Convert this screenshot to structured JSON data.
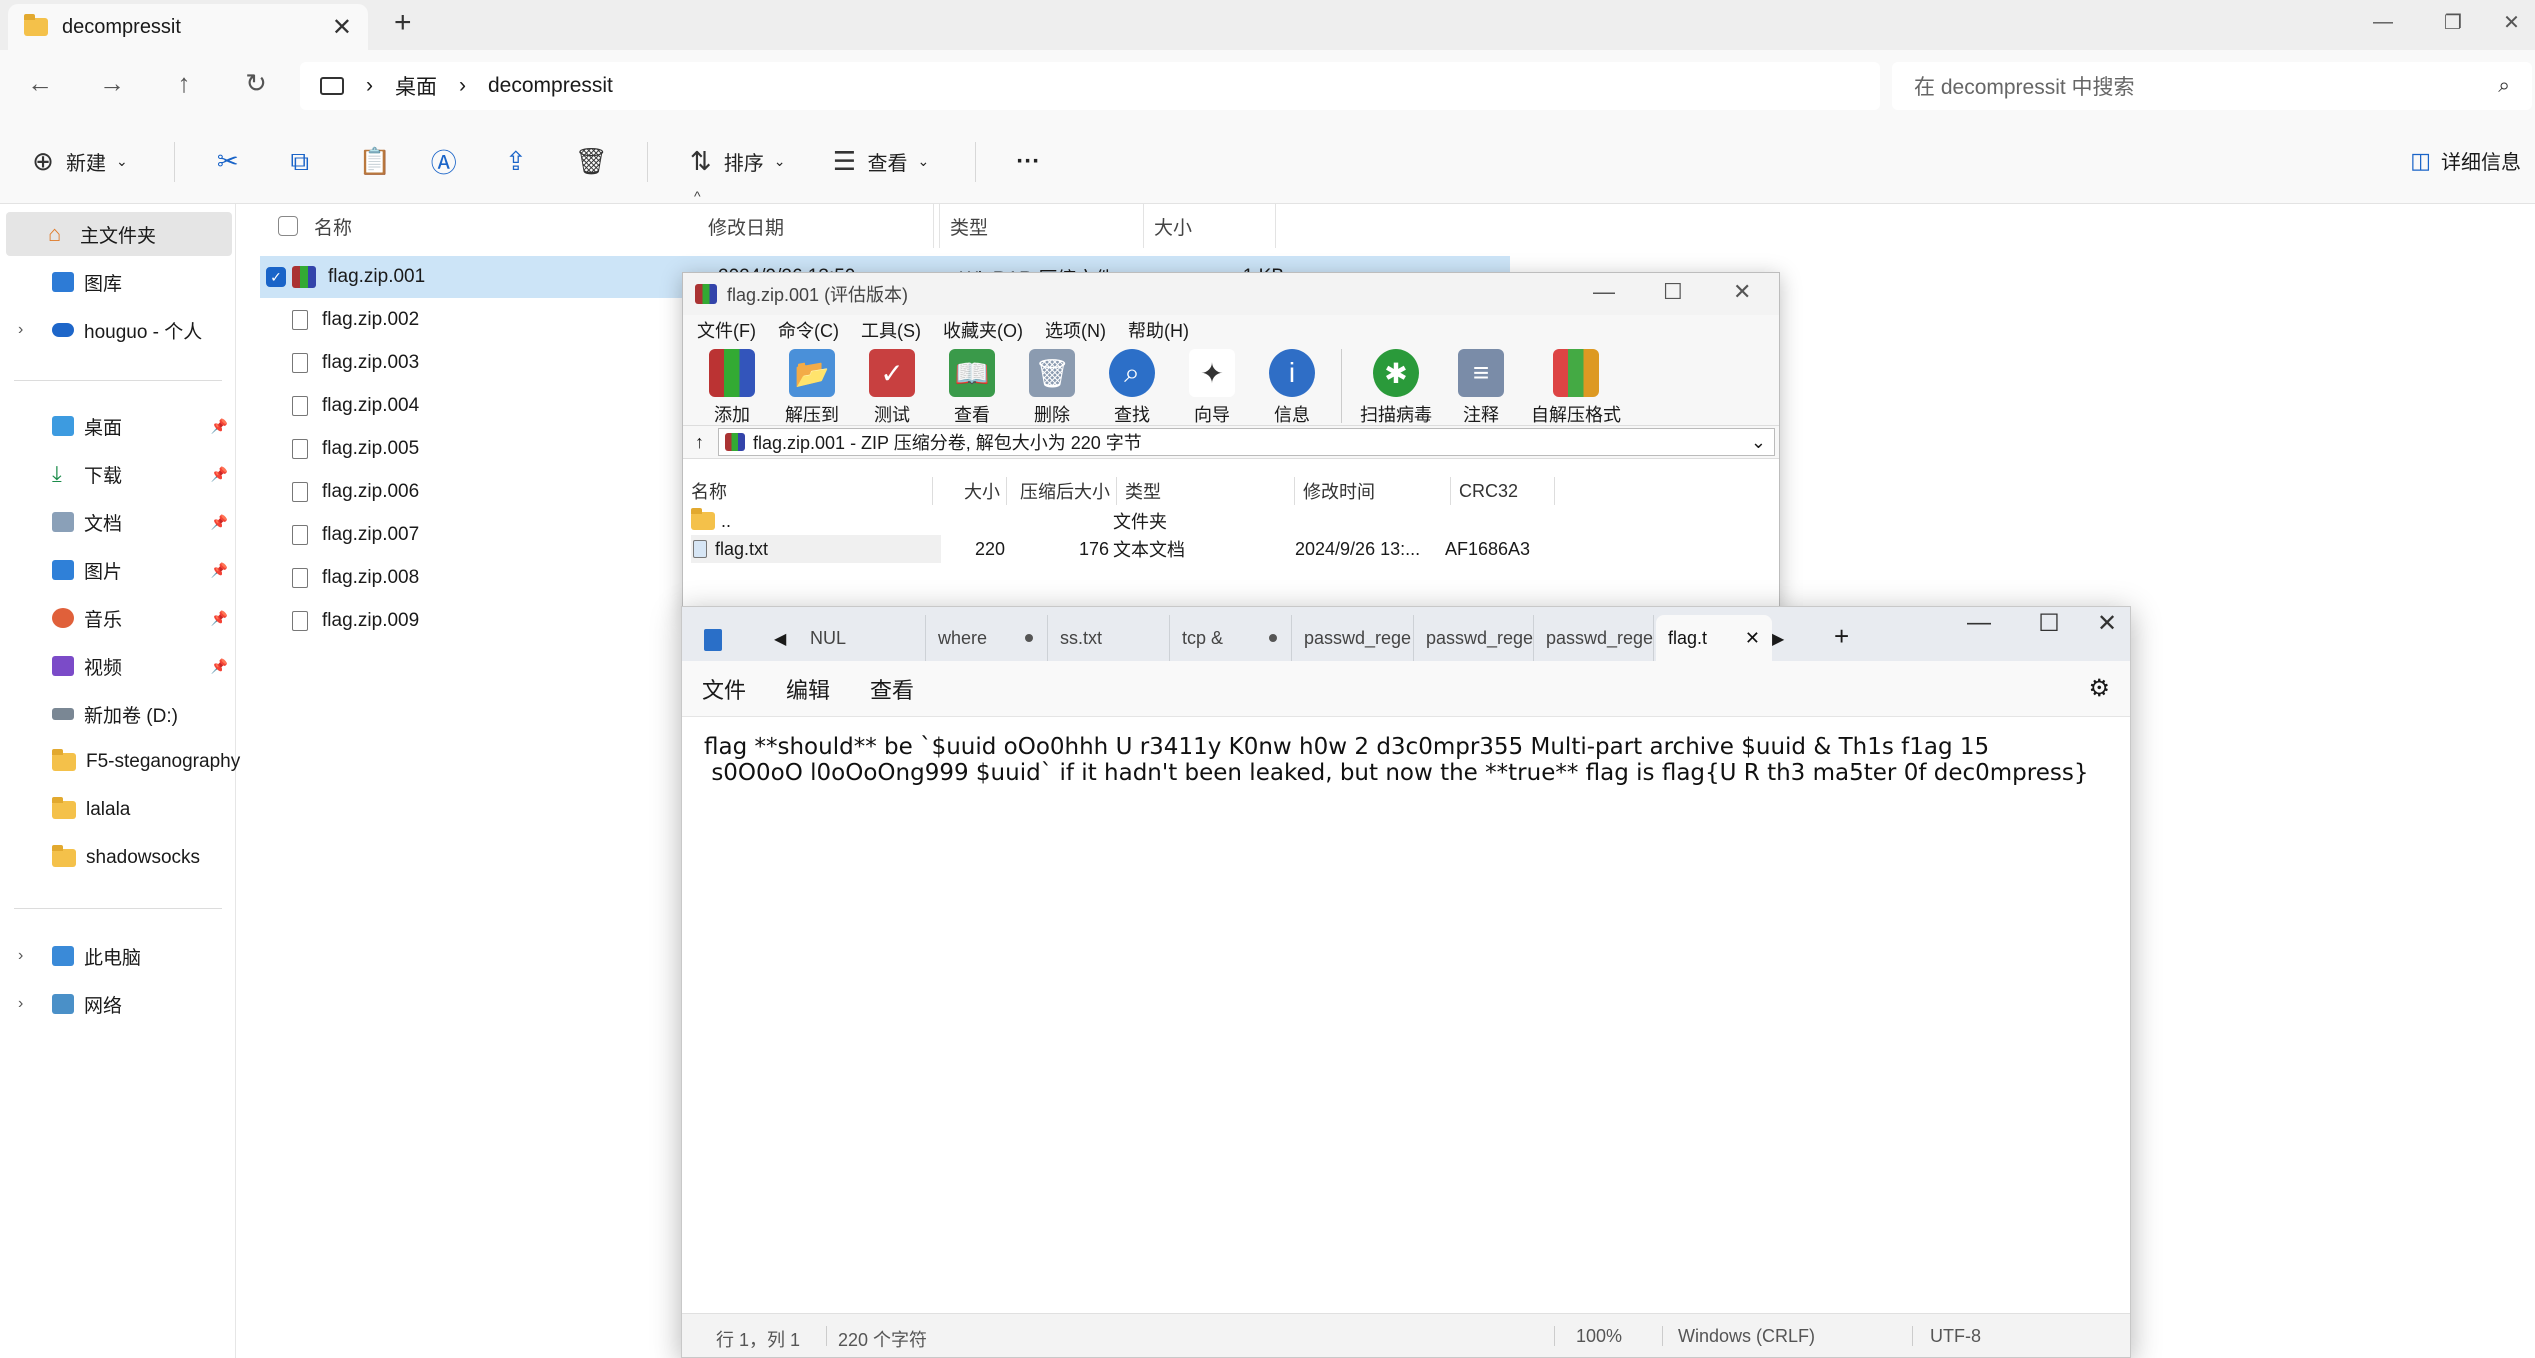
{
  "explorer": {
    "tab_title": "decompressit",
    "new_tab": "+",
    "breadcrumb": [
      "桌面",
      "decompressit"
    ],
    "search_placeholder": "在 decompressit 中搜索",
    "commands": {
      "new": "新建",
      "sort": "排序",
      "view": "查看",
      "more": "···",
      "details": "详细信息"
    },
    "sidebar": [
      {
        "label": "主文件夹",
        "icon": "home-icon",
        "pinned": false,
        "selected": true
      },
      {
        "label": "图库",
        "icon": "gallery-icon",
        "pinned": false
      },
      {
        "label": "houguo - 个人",
        "icon": "onedrive-icon",
        "pinned": false
      },
      {
        "label": "桌面",
        "icon": "desktop-icon",
        "pinned": true
      },
      {
        "label": "下载",
        "icon": "download-icon",
        "pinned": true
      },
      {
        "label": "文档",
        "icon": "documents-icon",
        "pinned": true
      },
      {
        "label": "图片",
        "icon": "pictures-icon",
        "pinned": true
      },
      {
        "label": "音乐",
        "icon": "music-icon",
        "pinned": true
      },
      {
        "label": "视频",
        "icon": "video-icon",
        "pinned": true
      },
      {
        "label": "新加卷 (D:)",
        "icon": "drive-icon",
        "pinned": false
      },
      {
        "label": "F5-steganography",
        "icon": "folder-icon",
        "pinned": false
      },
      {
        "label": "lalala",
        "icon": "folder-icon",
        "pinned": false
      },
      {
        "label": "shadowsocks",
        "icon": "folder-icon",
        "pinned": false
      },
      {
        "label": "此电脑",
        "icon": "computer-icon",
        "pinned": false
      },
      {
        "label": "网络",
        "icon": "network-icon",
        "pinned": false
      }
    ],
    "columns": [
      "名称",
      "修改日期",
      "类型",
      "大小"
    ],
    "files": [
      {
        "name": "flag.zip.001",
        "date": "2024/9/26 13:50",
        "type": "WinRAR 压缩文件",
        "size": "1 KB",
        "selected": true
      },
      {
        "name": "flag.zip.002"
      },
      {
        "name": "flag.zip.003"
      },
      {
        "name": "flag.zip.004"
      },
      {
        "name": "flag.zip.005"
      },
      {
        "name": "flag.zip.006"
      },
      {
        "name": "flag.zip.007"
      },
      {
        "name": "flag.zip.008"
      },
      {
        "name": "flag.zip.009"
      }
    ]
  },
  "winrar": {
    "title": "flag.zip.001 (评估版本)",
    "menu": [
      "文件(F)",
      "命令(C)",
      "工具(S)",
      "收藏夹(O)",
      "选项(N)",
      "帮助(H)"
    ],
    "tools": [
      "添加",
      "解压到",
      "测试",
      "查看",
      "删除",
      "查找",
      "向导",
      "信息",
      "扫描病毒",
      "注释",
      "自解压格式"
    ],
    "path": "flag.zip.001 - ZIP 压缩分卷, 解包大小为 220 字节",
    "columns": [
      "名称",
      "大小",
      "压缩后大小",
      "类型",
      "修改时间",
      "CRC32"
    ],
    "rows": [
      {
        "name": "..",
        "size": "",
        "packed": "",
        "type": "文件夹",
        "modified": "",
        "crc": ""
      },
      {
        "name": "flag.txt",
        "size": "220",
        "packed": "176",
        "type": "文本文档",
        "modified": "2024/9/26 13:...",
        "crc": "AF1686A3"
      }
    ]
  },
  "notepad": {
    "tabs": [
      "NUL",
      "where",
      "ss.txt",
      "tcp &",
      "passwd_rege",
      "passwd_rege",
      "passwd_rege",
      "flag.t"
    ],
    "menu": [
      "文件",
      "编辑",
      "查看"
    ],
    "content_line1": "flag **should** be `$uuid oOo0hhh U r3411y K0nw h0w 2 d3c0mpr355 Multi-part archive $uuid & Th1s f1ag 15",
    "content_line2": " s0O0oO l0oOoOng999 $uuid` if it hadn't been leaked, but now the **true** flag is flag{U R th3 ma5ter 0f dec0mpress}",
    "status": {
      "position": "行 1，列 1",
      "chars": "220 个字符",
      "zoom": "100%",
      "eol": "Windows (CRLF)",
      "encoding": "UTF-8"
    }
  }
}
